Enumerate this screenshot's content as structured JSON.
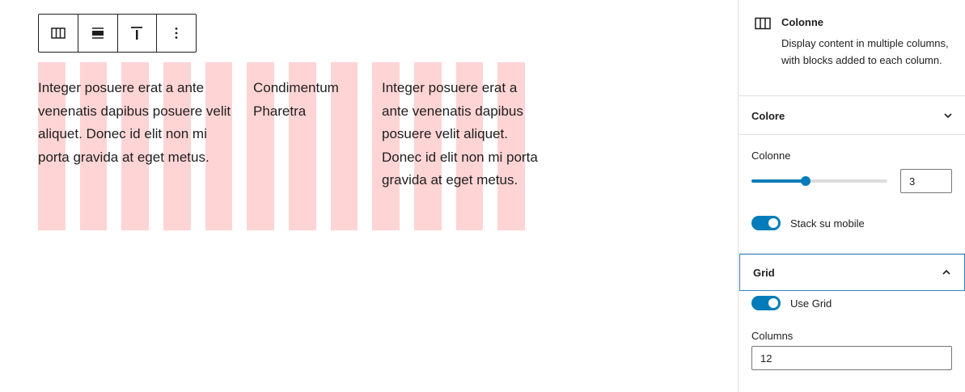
{
  "toolbar": {
    "buttons": [
      {
        "icon": "columns-icon"
      },
      {
        "icon": "align-icon"
      },
      {
        "icon": "vertical-align-top-icon"
      },
      {
        "icon": "more-options-icon"
      }
    ]
  },
  "grid": {
    "columns": 12,
    "stripe_color": "#ffd4d4"
  },
  "content": {
    "columns": [
      {
        "text": "Integer posuere erat a ante venenatis dapibus posuere velit aliquet. Donec id elit non mi porta gravida at eget metus."
      },
      {
        "text": "Condimentum Pharetra"
      },
      {
        "text": "Integer posuere erat a ante venenatis dapibus posuere velit aliquet. Donec id elit non mi porta gravida at eget metus."
      }
    ]
  },
  "sidebar": {
    "block": {
      "title": "Colonne",
      "description": "Display content in multiple columns, with blocks added to each column."
    },
    "color_panel": {
      "title": "Colore"
    },
    "columns_field": {
      "label": "Colonne",
      "value": "3",
      "fraction": 0.4
    },
    "stack_toggle": {
      "label": "Stack su mobile",
      "checked": true
    },
    "grid_panel": {
      "title": "Grid"
    },
    "use_grid_toggle": {
      "label": "Use Grid",
      "checked": true
    },
    "grid_columns_field": {
      "label": "Columns",
      "value": "12"
    }
  },
  "colors": {
    "accent": "#007cba",
    "focus": "#3582c4"
  }
}
